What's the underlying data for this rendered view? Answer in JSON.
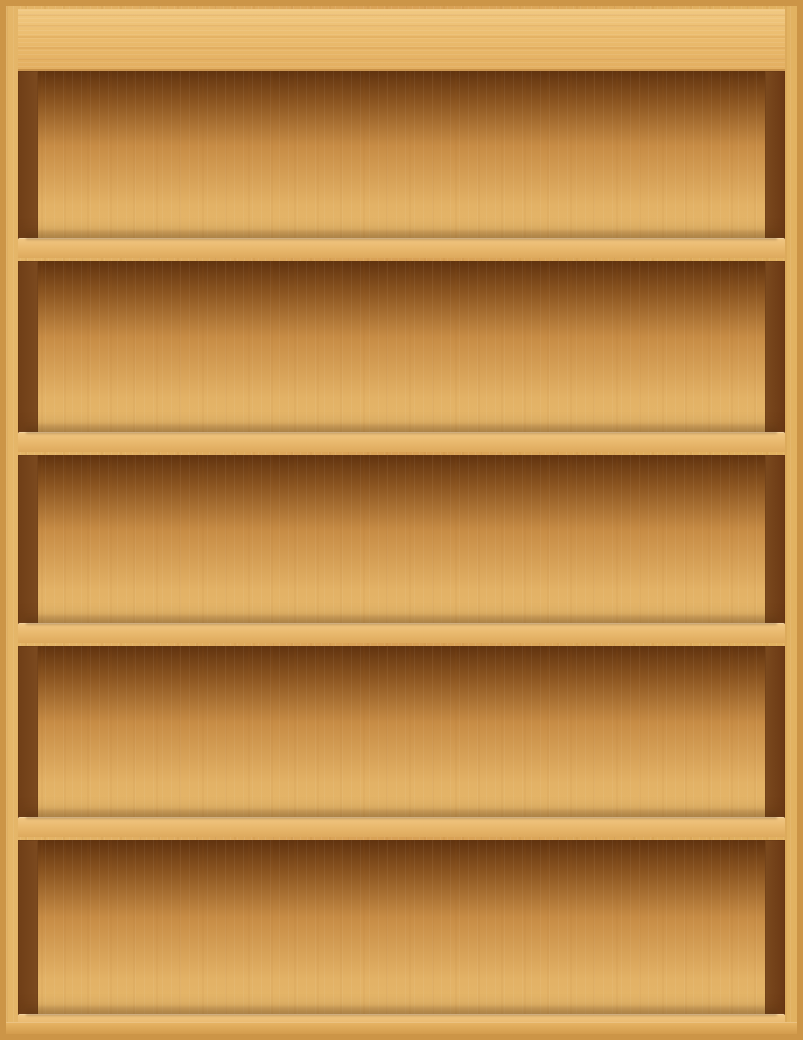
{
  "scene": {
    "object": "bookshelf",
    "shelf_count": 5,
    "style": "empty wooden bookcase",
    "colors": {
      "frame": "#d9a354",
      "top_board": "#ebbc6e",
      "back_panel_light": "#e5b86b",
      "back_panel_dark": "#61330f",
      "side_panel": "#6f3e17",
      "shelf_board": "#e9b96e"
    }
  }
}
